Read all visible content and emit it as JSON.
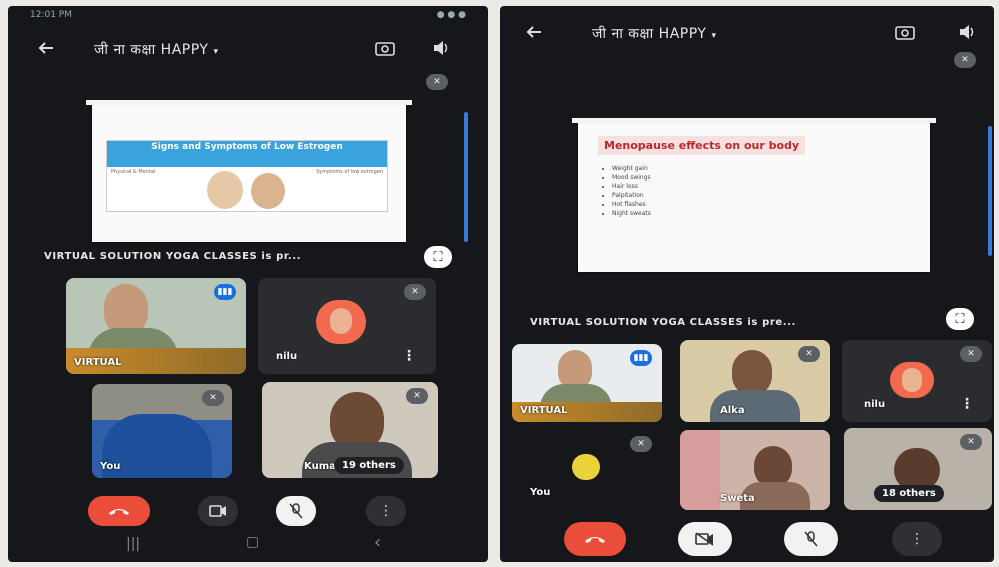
{
  "left": {
    "status": {
      "time": "12:01 PM",
      "right": "● ● ●"
    },
    "title": "जी ना कक्षा HAPPY",
    "title_caret": "▾",
    "slide": {
      "headline": "Signs and Symptoms of Low Estrogen",
      "caption_left": "Physical & Mental",
      "caption_right": "Symptoms of low estrogen"
    },
    "banner": "VIRTUAL SOLUTION YOGA CLASSES is pr...",
    "tiles": [
      {
        "name": "VIRTUAL"
      },
      {
        "name": "nilu"
      },
      {
        "name": "You"
      },
      {
        "name": "Kumar"
      }
    ],
    "others": "19 others",
    "nav": {
      "recent": "|||",
      "home": "▢",
      "back": "‹"
    },
    "colors": {
      "end_call": "#ea4d3a",
      "speaking": "#1a6fe0"
    }
  },
  "right": {
    "title": "जी ना कक्षा HAPPY",
    "title_caret": "▾",
    "slide": {
      "headline": "Menopause effects on our body",
      "bullets": [
        "Weight gain",
        "Mood swings",
        "Hair loss",
        "Palpitation",
        "Hot flashes",
        "Night sweats"
      ]
    },
    "banner": "VIRTUAL SOLUTION YOGA CLASSES is pre...",
    "tiles": [
      {
        "name": "VIRTUAL"
      },
      {
        "name": "Alka"
      },
      {
        "name": "nilu"
      },
      {
        "name": "You"
      },
      {
        "name": "Sweta"
      }
    ],
    "others": "18 others"
  },
  "icons": [
    "back-arrow-icon",
    "camera-flip-icon",
    "speaker-icon",
    "mic-off-icon",
    "more-vert-icon",
    "expand-icon",
    "end-call-icon",
    "camera-icon"
  ]
}
